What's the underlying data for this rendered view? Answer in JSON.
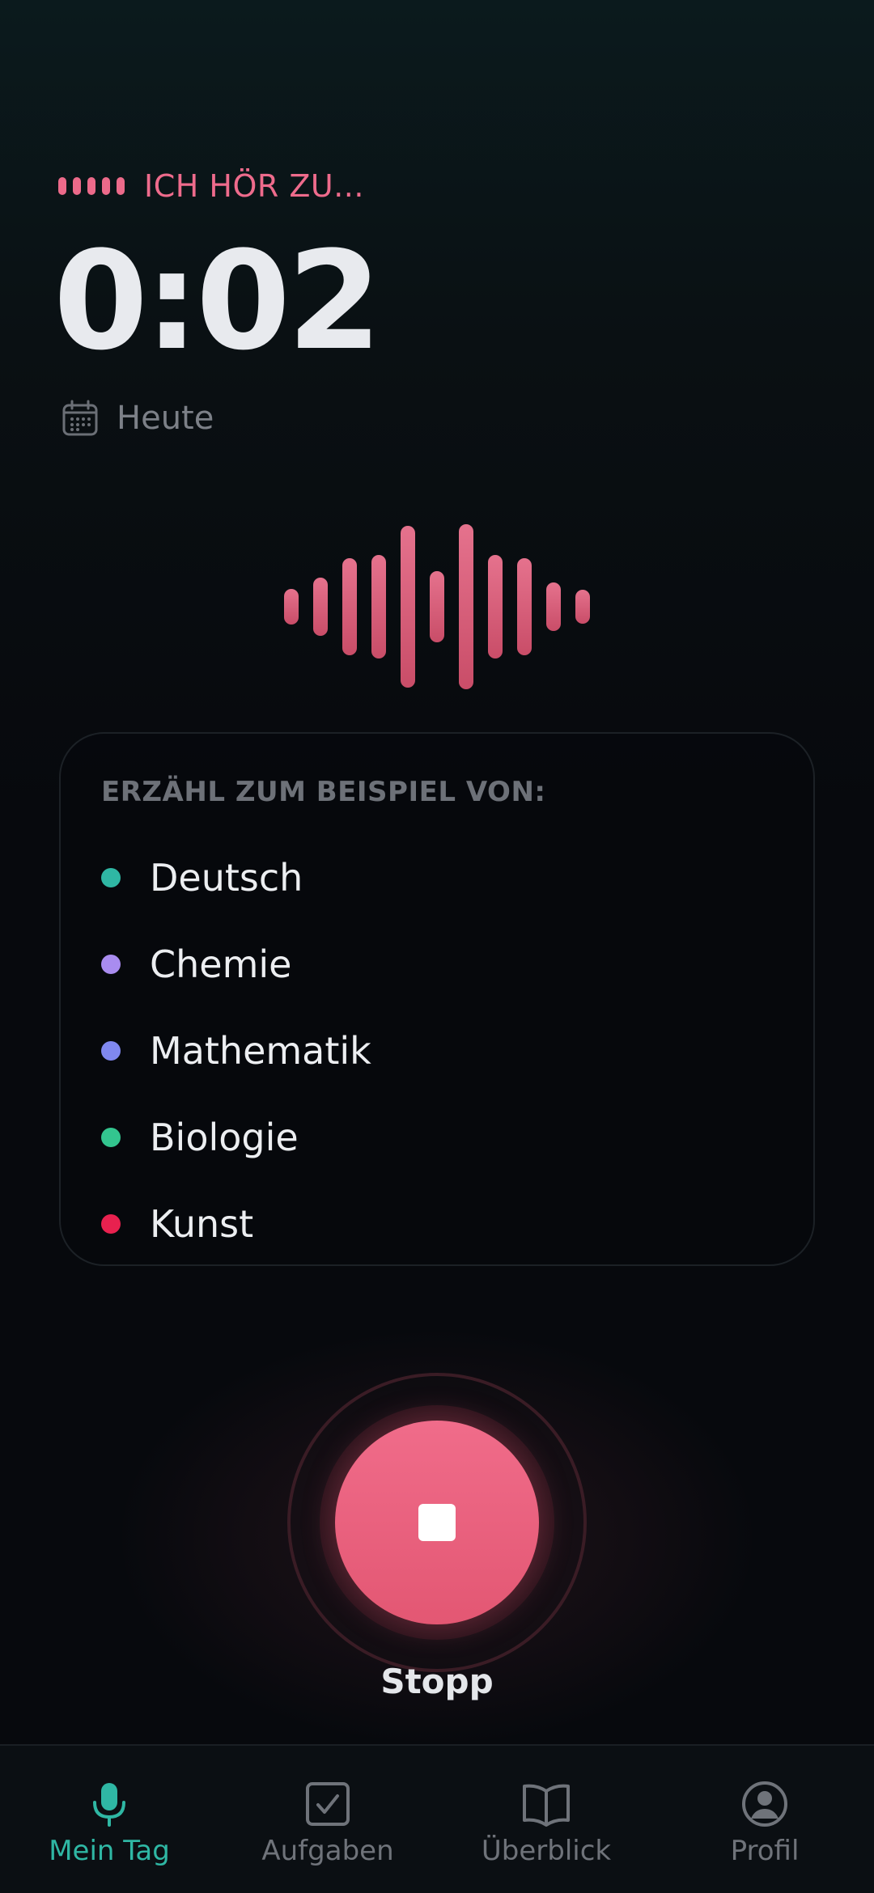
{
  "status": {
    "text": "ICH HÖR ZU...",
    "accent_color": "#ee6b8c"
  },
  "timer": {
    "value": "0:02"
  },
  "date": {
    "label": "Heute",
    "icon": "calendar-icon"
  },
  "examples": {
    "title": "ERZÄHL ZUM BEISPIEL VON:",
    "subjects": [
      {
        "label": "Deutsch",
        "color": "#2fb7a4"
      },
      {
        "label": "Chemie",
        "color": "#a98cf0"
      },
      {
        "label": "Mathematik",
        "color": "#8088f0"
      },
      {
        "label": "Biologie",
        "color": "#33c58f"
      },
      {
        "label": "Kunst",
        "color": "#e8214f"
      }
    ]
  },
  "stop": {
    "label": "Stopp",
    "icon": "stop-icon",
    "color": "#ec6382"
  },
  "nav": {
    "items": [
      {
        "label": "Mein Tag",
        "icon": "microphone-icon",
        "active": true
      },
      {
        "label": "Aufgaben",
        "icon": "checkbox-icon",
        "active": false
      },
      {
        "label": "Überblick",
        "icon": "book-icon",
        "active": false
      },
      {
        "label": "Profil",
        "icon": "user-icon",
        "active": false
      }
    ],
    "active_color": "#2fb7a4",
    "inactive_color": "#6f737a"
  }
}
